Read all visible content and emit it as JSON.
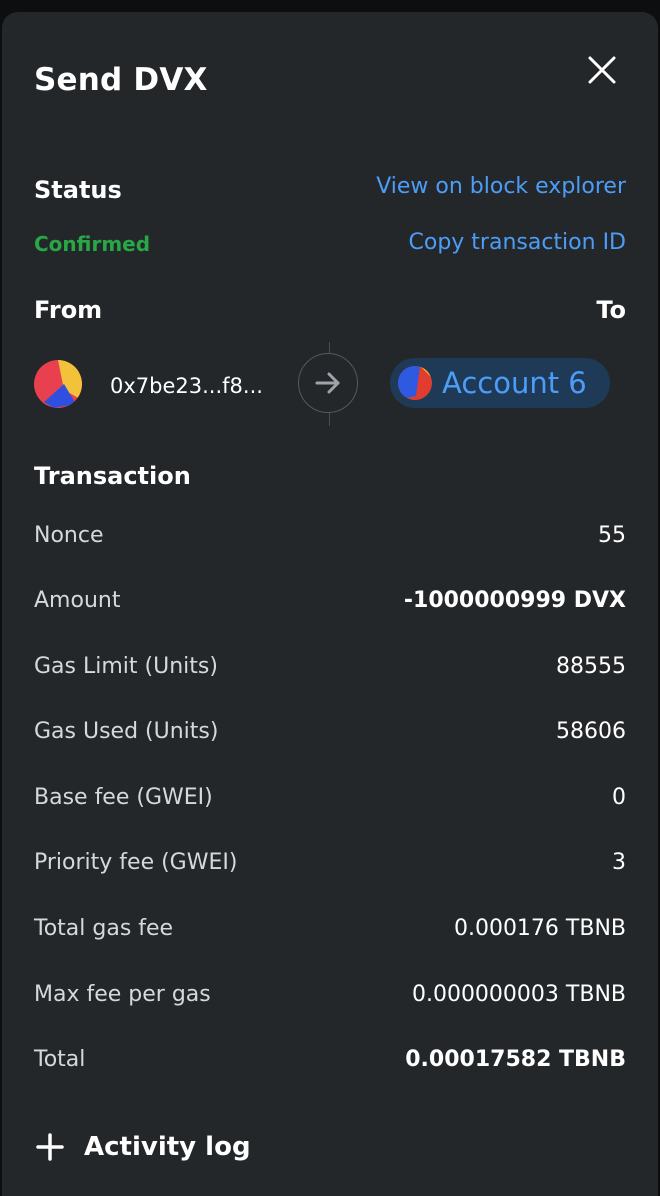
{
  "header": {
    "title": "Send DVX"
  },
  "status": {
    "label": "Status",
    "value": "Confirmed",
    "view_explorer": "View on block explorer",
    "copy_tx": "Copy transaction ID"
  },
  "parties": {
    "from_label": "From",
    "to_label": "To",
    "from_address": "0x7be23...f8...",
    "to_account": "Account 6"
  },
  "transaction": {
    "heading": "Transaction",
    "rows": [
      {
        "label": "Nonce",
        "value": "55"
      },
      {
        "label": "Amount",
        "value": "-1000000999 DVX"
      },
      {
        "label": "Gas Limit (Units)",
        "value": "88555"
      },
      {
        "label": "Gas Used (Units)",
        "value": "58606"
      },
      {
        "label": "Base fee (GWEI)",
        "value": "0"
      },
      {
        "label": "Priority fee (GWEI)",
        "value": "3"
      },
      {
        "label": "Total gas fee",
        "value": "0.000176 TBNB"
      },
      {
        "label": "Max fee per gas",
        "value": "0.000000003 TBNB"
      },
      {
        "label": "Total",
        "value": "0.00017582 TBNB"
      }
    ]
  },
  "activity": {
    "label": "Activity log"
  },
  "colors": {
    "accent": "#4c9df8",
    "success": "#28a745",
    "panel": "#24272a"
  }
}
